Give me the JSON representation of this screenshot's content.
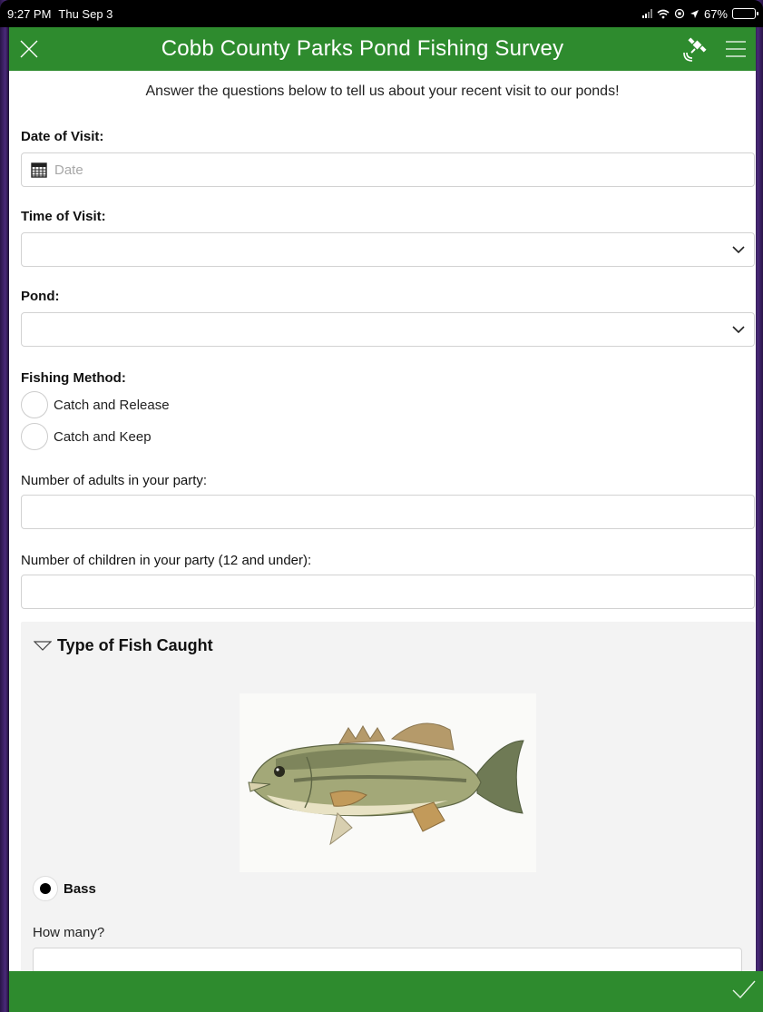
{
  "status_bar": {
    "time": "9:27 PM",
    "date": "Thu Sep 3",
    "battery": "67%",
    "battery_level": 0.67
  },
  "header": {
    "title": "Cobb County Parks Pond Fishing Survey",
    "close_icon": "close-icon",
    "gps_icon": "satellite-icon",
    "menu_icon": "hamburger-menu-icon",
    "color": "#2e8b2e"
  },
  "form": {
    "intro": "Answer the questions below to tell us about your recent visit to our ponds!",
    "date_label": "Date of Visit:",
    "date_placeholder": "Date",
    "time_label": "Time of Visit:",
    "time_value": "",
    "pond_label": "Pond:",
    "pond_value": "",
    "method_label": "Fishing Method:",
    "method_options": [
      "Catch and Release",
      "Catch and Keep"
    ],
    "adults_label": "Number of adults in your party:",
    "adults_value": "",
    "children_label": "Number of children in your party (12 and under):",
    "children_value": ""
  },
  "fish_group": {
    "title": "Type of Fish Caught",
    "option_label": "Bass",
    "option_selected": true,
    "how_many_label": "How many?",
    "how_many_value": ""
  },
  "footer": {
    "submit_icon": "checkmark-icon"
  }
}
